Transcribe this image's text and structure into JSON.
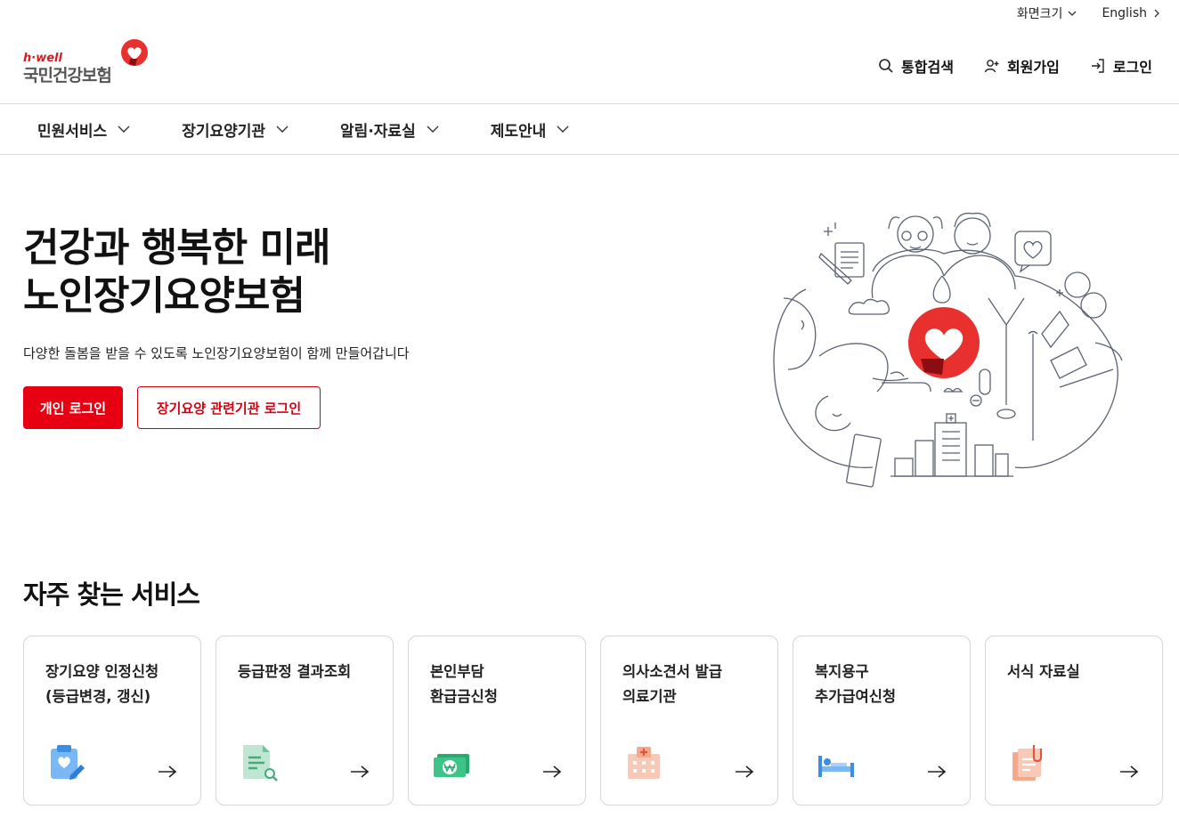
{
  "util": {
    "font_size": "화면크기",
    "language": "English"
  },
  "logo": {
    "tagline": "h·well",
    "name": "국민건강보험"
  },
  "header": {
    "search": "통합검색",
    "signup": "회원가입",
    "login": "로그인"
  },
  "gnb": [
    {
      "label": "민원서비스"
    },
    {
      "label": "장기요양기관"
    },
    {
      "label": "알림·자료실"
    },
    {
      "label": "제도안내"
    }
  ],
  "hero": {
    "title_line1": "건강과 행복한 미래",
    "title_line2": "노인장기요양보험",
    "subtitle": "다양한 돌봄을 받을 수 있도록 노인장기요양보험이 함께 만들어갑니다",
    "btn_personal": "개인 로그인",
    "btn_institution": "장기요양 관련기관 로그인"
  },
  "services": {
    "title": "자주 찾는 서비스",
    "cards": [
      {
        "line1": "장기요양 인정신청",
        "line2": "(등급변경, 갱신)",
        "icon": "clipboard-heart-icon"
      },
      {
        "line1": "등급판정 결과조회",
        "line2": "",
        "icon": "document-search-icon"
      },
      {
        "line1": "본인부담",
        "line2": "환급금신청",
        "icon": "won-banknote-icon"
      },
      {
        "line1": "의사소견서 발급",
        "line2": "의료기관",
        "icon": "hospital-icon"
      },
      {
        "line1": "복지용구",
        "line2": "추가급여신청",
        "icon": "bed-icon"
      },
      {
        "line1": "서식 자료실",
        "line2": "",
        "icon": "clipped-documents-icon"
      }
    ]
  },
  "colors": {
    "brand_red": "#e60012",
    "text": "#111111"
  }
}
